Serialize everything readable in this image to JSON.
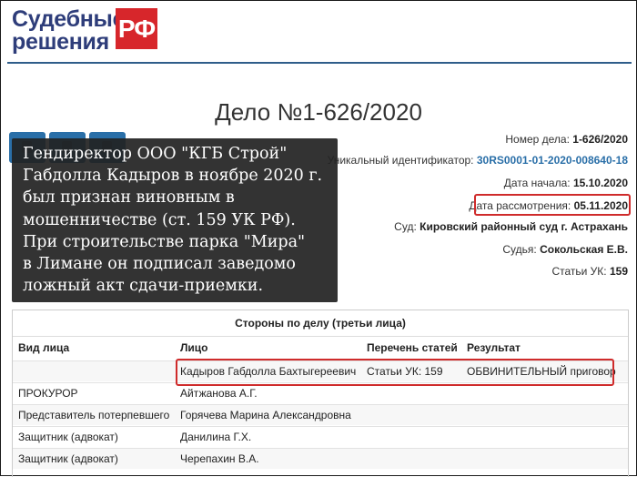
{
  "logo": {
    "line1": "Судебные",
    "line2": "решения",
    "badge": "РФ"
  },
  "case": {
    "title": "Дело №1-626/2020"
  },
  "info": {
    "case_number_label": "Номер дела:",
    "case_number": "1-626/2020",
    "uid_label": "Уникальный идентификатор:",
    "uid": "30RS0001-01-2020-008640-18",
    "start_label": "Дата начала:",
    "start": "15.10.2020",
    "review_label": "Дата рассмотрения:",
    "review": "05.11.2020",
    "court_label": "Суд:",
    "court": "Кировский районный суд г. Астрахань",
    "judge_label": "Судья:",
    "judge": "Сокольская Е.В.",
    "articles_label": "Статьи УК:",
    "articles": "159"
  },
  "overlay": {
    "lines": [
      "Гендиректор ООО \"КГБ Строй\"",
      "Габдолла Кадыров в ноябре 2020 г.",
      "был признан виновным в",
      "мошенничестве (ст. 159 УК РФ).",
      "При строительстве парка \"Мира\"",
      "в Лимане он подписал заведомо",
      "ложный акт сдачи-приемки."
    ]
  },
  "table": {
    "caption": "Стороны по делу (третьи лица)",
    "headers": [
      "Вид лица",
      "Лицо",
      "Перечень статей",
      "Результат"
    ],
    "rows": [
      [
        "",
        "Кадыров Габдолла Бахтыгереевич",
        "Статьи УК: 159",
        "ОБВИНИТЕЛЬНЫЙ приговор"
      ],
      [
        "ПРОКУРОР",
        "Айтжанова А.Г.",
        "",
        ""
      ],
      [
        "Представитель потерпевшего",
        "Горячева Марина Александровна",
        "",
        ""
      ],
      [
        "Защитник (адвокат)",
        "Данилина Г.Х.",
        "",
        ""
      ],
      [
        "Защитник (адвокат)",
        "Черепахин В.А.",
        "",
        ""
      ]
    ]
  },
  "colors": {
    "brand_blue": "#2e3d7a",
    "brand_red": "#d7262b",
    "link": "#2a6fa8",
    "highlight": "#cf2b2b"
  }
}
